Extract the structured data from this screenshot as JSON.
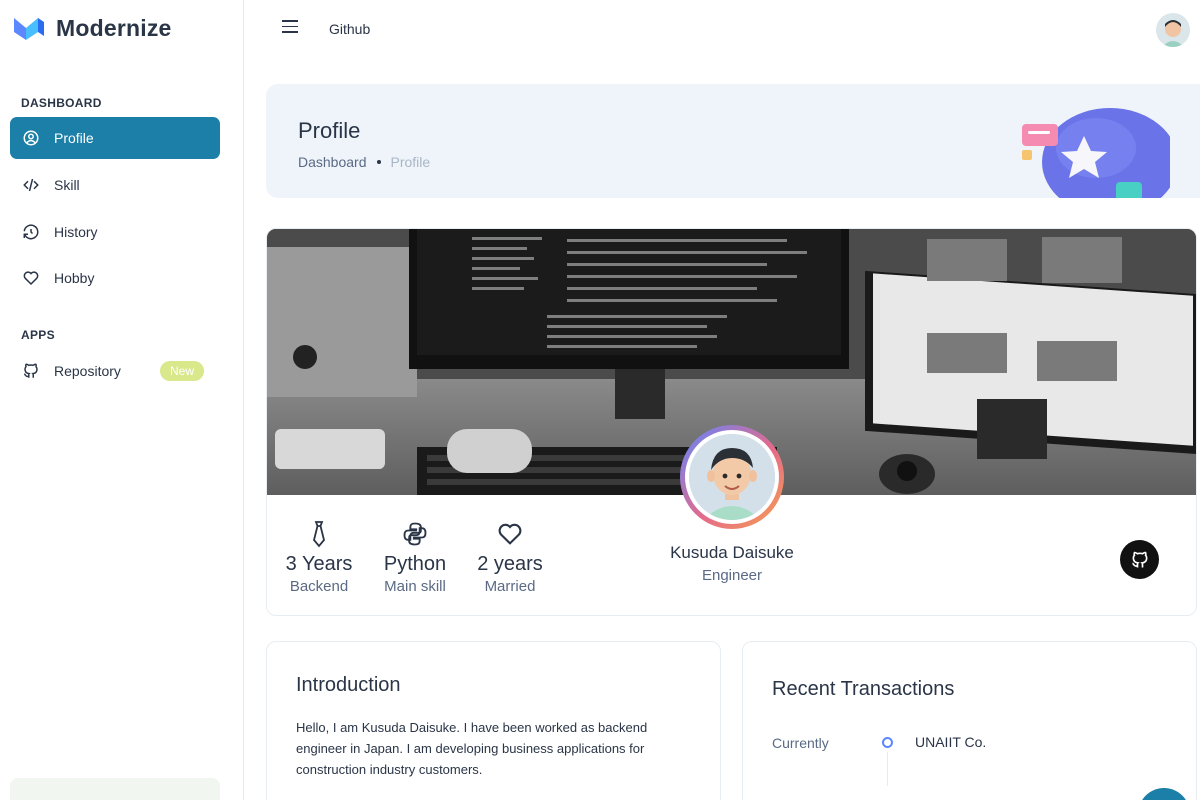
{
  "brand": {
    "name": "Modernize"
  },
  "sidebar": {
    "sections": [
      {
        "caption": "DASHBOARD"
      },
      {
        "caption": "APPS"
      }
    ],
    "items": [
      {
        "label": "Profile",
        "icon": "user-circle-icon",
        "active": true
      },
      {
        "label": "Skill",
        "icon": "code-icon",
        "active": false
      },
      {
        "label": "History",
        "icon": "history-icon",
        "active": false
      },
      {
        "label": "Hobby",
        "icon": "heart-icon",
        "active": false
      },
      {
        "label": "Repository",
        "icon": "github-icon",
        "active": false,
        "badge": "New"
      }
    ]
  },
  "header": {
    "link": "Github"
  },
  "breadcrumb": {
    "title": "Profile",
    "path": [
      "Dashboard",
      "Profile"
    ]
  },
  "profile": {
    "name": "Kusuda Daisuke",
    "role": "Engineer",
    "stats": [
      {
        "value": "3 Years",
        "label": "Backend",
        "icon": "tie-icon"
      },
      {
        "value": "Python",
        "label": "Main skill",
        "icon": "python-icon"
      },
      {
        "value": "2 years",
        "label": "Married",
        "icon": "heart-icon"
      }
    ]
  },
  "introduction": {
    "title": "Introduction",
    "text": "Hello, I am Kusuda Daisuke. I have been worked as backend engineer in Japan. I am developing business applications for construction industry customers."
  },
  "transactions": {
    "title": "Recent Transactions",
    "items": [
      {
        "time": "Currently",
        "name": "UNAIIT Co."
      }
    ]
  },
  "colors": {
    "primary": "#1b7fa8",
    "accent": "#5d87ff",
    "badge": "#d8e88a"
  }
}
